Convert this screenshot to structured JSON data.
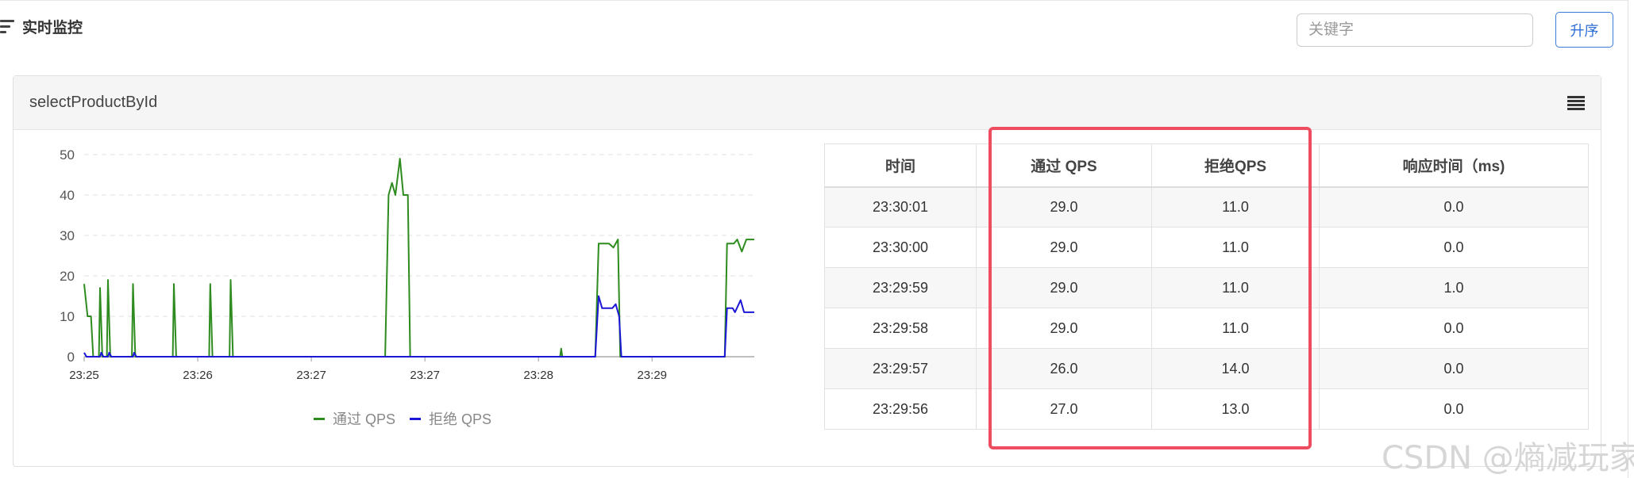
{
  "header": {
    "title": "实时监控",
    "icon": "list-filter-icon"
  },
  "search": {
    "placeholder": "关键字",
    "value": ""
  },
  "sort_button": {
    "label": "升序"
  },
  "panel": {
    "resource": "selectProductById",
    "menu_icon": "list-icon"
  },
  "legend": {
    "pass": "通过 QPS",
    "block": "拒绝 QPS"
  },
  "table": {
    "headers": [
      "时间",
      "通过 QPS",
      "拒绝QPS",
      "响应时间（ms)"
    ],
    "rows": [
      [
        "23:30:01",
        "29.0",
        "11.0",
        "0.0"
      ],
      [
        "23:30:00",
        "29.0",
        "11.0",
        "0.0"
      ],
      [
        "23:29:59",
        "29.0",
        "11.0",
        "1.0"
      ],
      [
        "23:29:58",
        "29.0",
        "11.0",
        "0.0"
      ],
      [
        "23:29:57",
        "26.0",
        "14.0",
        "0.0"
      ],
      [
        "23:29:56",
        "27.0",
        "13.0",
        "0.0"
      ]
    ]
  },
  "watermark": "CSDN @熵减玩家",
  "colors": {
    "pass": "#2e8b1f",
    "block": "#1c17d6",
    "highlight": "#ee4c5f",
    "accent": "#2f6fd6"
  },
  "chart_data": {
    "type": "line",
    "ylim": [
      0,
      50
    ],
    "y_ticks": [
      0,
      10,
      20,
      30,
      40,
      50
    ],
    "x_ticks": [
      "23:25",
      "23:26",
      "23:27",
      "23:27",
      "23:28",
      "23:29"
    ],
    "x_tick_minutes": [
      0,
      1,
      2,
      3,
      4,
      5
    ],
    "x_range_minutes": [
      0,
      5.9
    ],
    "grid": true,
    "legend_position": "bottom",
    "series": [
      {
        "name": "通过 QPS",
        "points": [
          [
            0.0,
            18
          ],
          [
            0.03,
            10
          ],
          [
            0.06,
            10
          ],
          [
            0.08,
            0
          ],
          [
            0.13,
            0
          ],
          [
            0.14,
            17
          ],
          [
            0.16,
            0
          ],
          [
            0.2,
            0
          ],
          [
            0.21,
            19
          ],
          [
            0.23,
            0
          ],
          [
            0.42,
            0
          ],
          [
            0.43,
            18
          ],
          [
            0.45,
            0
          ],
          [
            0.78,
            0
          ],
          [
            0.79,
            18
          ],
          [
            0.81,
            0
          ],
          [
            1.1,
            0
          ],
          [
            1.11,
            18
          ],
          [
            1.13,
            0
          ],
          [
            1.28,
            0
          ],
          [
            1.29,
            19
          ],
          [
            1.31,
            0
          ],
          [
            2.65,
            0
          ],
          [
            2.68,
            40
          ],
          [
            2.71,
            43
          ],
          [
            2.74,
            40
          ],
          [
            2.78,
            49
          ],
          [
            2.81,
            40
          ],
          [
            2.85,
            40
          ],
          [
            2.87,
            0
          ],
          [
            4.19,
            0
          ],
          [
            4.2,
            2
          ],
          [
            4.21,
            0
          ],
          [
            4.5,
            0
          ],
          [
            4.53,
            28
          ],
          [
            4.62,
            28
          ],
          [
            4.66,
            27
          ],
          [
            4.7,
            29
          ],
          [
            4.72,
            0
          ],
          [
            5.64,
            0
          ],
          [
            5.66,
            28
          ],
          [
            5.72,
            28
          ],
          [
            5.75,
            29
          ],
          [
            5.79,
            26
          ],
          [
            5.83,
            29
          ],
          [
            5.9,
            29
          ]
        ]
      },
      {
        "name": "拒绝 QPS",
        "points": [
          [
            0.0,
            1
          ],
          [
            0.02,
            0
          ],
          [
            0.14,
            0
          ],
          [
            0.15,
            1
          ],
          [
            0.17,
            0
          ],
          [
            0.21,
            0
          ],
          [
            0.22,
            1
          ],
          [
            0.24,
            0
          ],
          [
            0.43,
            0
          ],
          [
            0.44,
            1
          ],
          [
            0.46,
            0
          ],
          [
            4.5,
            0
          ],
          [
            4.53,
            15
          ],
          [
            4.56,
            12
          ],
          [
            4.65,
            12
          ],
          [
            4.68,
            13
          ],
          [
            4.71,
            10
          ],
          [
            4.73,
            0
          ],
          [
            5.64,
            0
          ],
          [
            5.66,
            12
          ],
          [
            5.71,
            12
          ],
          [
            5.73,
            11
          ],
          [
            5.78,
            14
          ],
          [
            5.81,
            11
          ],
          [
            5.9,
            11
          ]
        ]
      }
    ]
  }
}
